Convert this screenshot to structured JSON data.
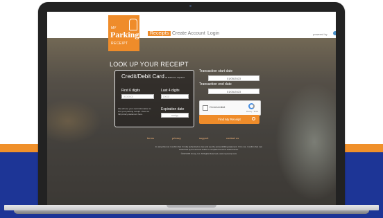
{
  "header": {
    "logo": {
      "line1": "MY",
      "line2": "Parking",
      "line3": "RECEIPT"
    },
    "nav": [
      {
        "label": "Receipts",
        "active": true
      },
      {
        "label": "Create Account"
      },
      {
        "label": "Login"
      }
    ],
    "powered_by": "powered by"
  },
  "lookup": {
    "title": "LOOK UP YOUR RECEIPT",
    "card_panel": {
      "title": "Credit/Debit Card",
      "required_note": "all fields are required",
      "first6_label": "First 6 digits",
      "first6_placeholder": "XXXXXX",
      "last4_label": "Last 4 digits",
      "last4_placeholder": "XXXX",
      "expiration_label": "Expiration date",
      "expiration_placeholder": "mm/yy",
      "info_note": "We will use your card information to find your parking receipt. View our full privacy statement here."
    },
    "transaction_start_label": "Transaction start date",
    "transaction_start_value": "01/05/2023",
    "transaction_end_label": "Transaction end date",
    "transaction_end_value": "01/05/2023",
    "captcha": {
      "label": "I'm not a robot",
      "brand": "reCAPTCHA",
      "sub": "Privacy - Terms"
    },
    "find_button": "Find My Receipt"
  },
  "footer": {
    "links": [
      "terms",
      "privacy",
      "support",
      "contact us"
    ],
    "legal_1": "In using this tool I confirm that I'm fully authorized to view and use the account/billing statement. If it is not, I confirm that I am authorized by the account holder to complete the terms stated herein.",
    "legal_2": "©2023 IPS Group, Inc. All Rights Reserved  |  www.myreceipt.com"
  },
  "colors": {
    "brand_orange": "#ef8c2a",
    "band_blue": "#1d3596",
    "band_orange": "#f0902a"
  },
  "icons": [
    "search-icon",
    "recaptcha-icon",
    "logo-mark-icon",
    "camera-icon"
  ]
}
